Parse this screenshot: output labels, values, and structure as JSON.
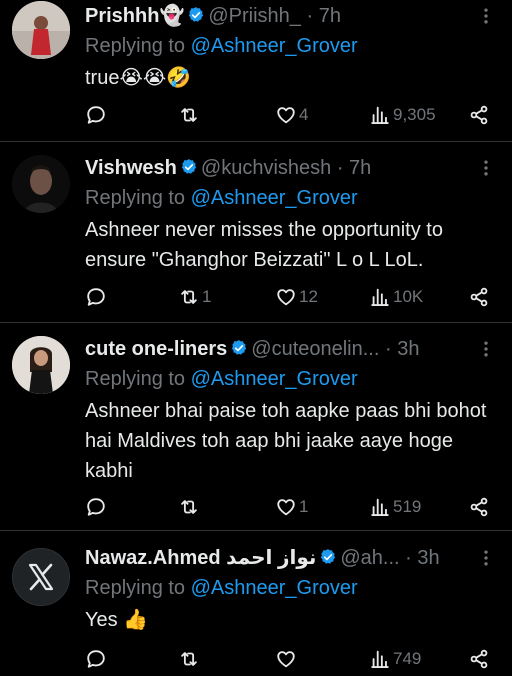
{
  "colors": {
    "background": "#000000",
    "text": "#e7e9ea",
    "muted": "#71767b",
    "accent": "#1d9bf0",
    "divider": "#2f3336"
  },
  "tweets": [
    {
      "name": "Prishhh👻",
      "handle": "@Priishh_",
      "time": "· 7h",
      "replying_prefix": "Replying to ",
      "replying_to": "@Ashneer_Grover",
      "text": "true😭😭🤣",
      "replies": "",
      "retweets": "",
      "likes": "4",
      "views": "9,305"
    },
    {
      "name": "Vishwesh",
      "handle": "@kuchvishesh",
      "time": "· 7h",
      "replying_prefix": "Replying to ",
      "replying_to": "@Ashneer_Grover",
      "text": "Ashneer never misses the opportunity to ensure \"Ghanghor Beizzati\" L o L LoL.",
      "replies": "",
      "retweets": "1",
      "likes": "12",
      "views": "10K"
    },
    {
      "name": "cute one-liners",
      "handle": "@cuteonelin...",
      "time": "· 3h",
      "replying_prefix": "Replying to ",
      "replying_to": "@Ashneer_Grover",
      "text": "Ashneer bhai paise toh aapke paas bhi bohot hai Maldives toh aap bhi jaake aaye hoge kabhi",
      "replies": "",
      "retweets": "",
      "likes": "1",
      "views": "519"
    },
    {
      "name": "Nawaz.Ahmed نواز احمد",
      "handle": "@ah...",
      "time": "· 3h",
      "replying_prefix": "Replying to ",
      "replying_to": "@Ashneer_Grover",
      "text": "Yes 👍",
      "replies": "",
      "retweets": "",
      "likes": "",
      "views": "749"
    }
  ],
  "icons": [
    "verified-badge-icon",
    "more-options-icon",
    "reply-icon",
    "retweet-icon",
    "like-icon",
    "views-icon",
    "share-icon",
    "x-logo-icon"
  ]
}
